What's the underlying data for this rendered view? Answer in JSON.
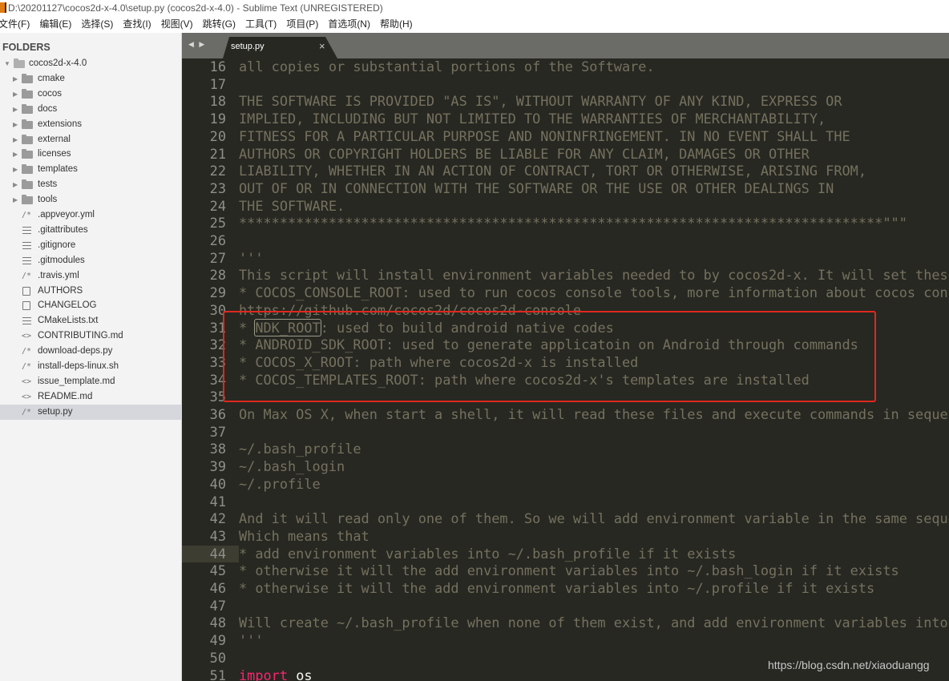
{
  "window": {
    "title": "D:\\20201127\\cocos2d-x-4.0\\setup.py (cocos2d-x-4.0) - Sublime Text (UNREGISTERED)",
    "app_icon": "sublime-text-icon"
  },
  "menubar": {
    "items": [
      "文件(F)",
      "编辑(E)",
      "选择(S)",
      "查找(I)",
      "视图(V)",
      "跳转(G)",
      "工具(T)",
      "项目(P)",
      "首选项(N)",
      "帮助(H)"
    ]
  },
  "sidebar": {
    "header": "FOLDERS",
    "root": {
      "label": "cocos2d-x-4.0",
      "icon": "folder-open-icon",
      "expanded": true
    },
    "folders": [
      {
        "label": "cmake",
        "icon": "folder-icon"
      },
      {
        "label": "cocos",
        "icon": "folder-icon"
      },
      {
        "label": "docs",
        "icon": "folder-icon"
      },
      {
        "label": "extensions",
        "icon": "folder-icon"
      },
      {
        "label": "external",
        "icon": "folder-icon"
      },
      {
        "label": "licenses",
        "icon": "folder-icon"
      },
      {
        "label": "templates",
        "icon": "folder-icon"
      },
      {
        "label": "tests",
        "icon": "folder-icon"
      },
      {
        "label": "tools",
        "icon": "folder-icon"
      }
    ],
    "files": [
      {
        "label": ".appveyor.yml",
        "icon": "comment-file-icon",
        "glyph": "/*"
      },
      {
        "label": ".gitattributes",
        "icon": "text-lines-icon",
        "glyph": ""
      },
      {
        "label": ".gitignore",
        "icon": "text-lines-icon",
        "glyph": ""
      },
      {
        "label": ".gitmodules",
        "icon": "text-lines-icon",
        "glyph": ""
      },
      {
        "label": ".travis.yml",
        "icon": "comment-file-icon",
        "glyph": "/*"
      },
      {
        "label": "AUTHORS",
        "icon": "document-icon",
        "glyph": ""
      },
      {
        "label": "CHANGELOG",
        "icon": "document-icon",
        "glyph": ""
      },
      {
        "label": "CMakeLists.txt",
        "icon": "text-lines-icon",
        "glyph": ""
      },
      {
        "label": "CONTRIBUTING.md",
        "icon": "markup-file-icon",
        "glyph": "<>"
      },
      {
        "label": "download-deps.py",
        "icon": "comment-file-icon",
        "glyph": "/*"
      },
      {
        "label": "install-deps-linux.sh",
        "icon": "comment-file-icon",
        "glyph": "/*"
      },
      {
        "label": "issue_template.md",
        "icon": "markup-file-icon",
        "glyph": "<>"
      },
      {
        "label": "README.md",
        "icon": "markup-file-icon",
        "glyph": "<>"
      },
      {
        "label": "setup.py",
        "icon": "comment-file-icon",
        "glyph": "/*",
        "selected": true
      }
    ]
  },
  "tabs": {
    "nav_glyph": "◀ ▶",
    "items": [
      {
        "label": "setup.py",
        "close": "×",
        "active": true
      }
    ]
  },
  "editor": {
    "active_line": 44,
    "lines": [
      {
        "n": "16",
        "text": "all copies or substantial portions of the Software."
      },
      {
        "n": "17",
        "text": ""
      },
      {
        "n": "18",
        "text": "THE SOFTWARE IS PROVIDED \"AS IS\", WITHOUT WARRANTY OF ANY KIND, EXPRESS OR"
      },
      {
        "n": "19",
        "text": "IMPLIED, INCLUDING BUT NOT LIMITED TO THE WARRANTIES OF MERCHANTABILITY,"
      },
      {
        "n": "20",
        "text": "FITNESS FOR A PARTICULAR PURPOSE AND NONINFRINGEMENT. IN NO EVENT SHALL THE"
      },
      {
        "n": "21",
        "text": "AUTHORS OR COPYRIGHT HOLDERS BE LIABLE FOR ANY CLAIM, DAMAGES OR OTHER"
      },
      {
        "n": "22",
        "text": "LIABILITY, WHETHER IN AN ACTION OF CONTRACT, TORT OR OTHERWISE, ARISING FROM,"
      },
      {
        "n": "23",
        "text": "OUT OF OR IN CONNECTION WITH THE SOFTWARE OR THE USE OR OTHER DEALINGS IN"
      },
      {
        "n": "24",
        "text": "THE SOFTWARE."
      },
      {
        "n": "25",
        "text": "*******************************************************************************\"\"\""
      },
      {
        "n": "26",
        "text": ""
      },
      {
        "n": "27",
        "text": "'''"
      },
      {
        "n": "28",
        "text": "This script will install environment variables needed to by cocos2d-x. It will set these envrironment variables:"
      },
      {
        "n": "29",
        "text": "* COCOS_CONSOLE_ROOT: used to run cocos console tools, more information about cocos console tools please refer to"
      },
      {
        "n": "30",
        "text": "https://github.com/cocos2d/cocos2d-console"
      },
      {
        "n": "31",
        "text": "* NDK_ROOT: used to build android native codes",
        "boxed_token": "NDK_ROOT"
      },
      {
        "n": "32",
        "text": "* ANDROID_SDK_ROOT: used to generate applicatoin on Android through commands"
      },
      {
        "n": "33",
        "text": "* COCOS_X_ROOT: path where cocos2d-x is installed"
      },
      {
        "n": "34",
        "text": "* COCOS_TEMPLATES_ROOT: path where cocos2d-x's templates are installed"
      },
      {
        "n": "35",
        "text": ""
      },
      {
        "n": "36",
        "text": "On Max OS X, when start a shell, it will read these files and execute commands in sequence:"
      },
      {
        "n": "37",
        "text": ""
      },
      {
        "n": "38",
        "text": "~/.bash_profile"
      },
      {
        "n": "39",
        "text": "~/.bash_login"
      },
      {
        "n": "40",
        "text": "~/.profile"
      },
      {
        "n": "41",
        "text": ""
      },
      {
        "n": "42",
        "text": "And it will read only one of them. So we will add environment variable in the same sequence."
      },
      {
        "n": "43",
        "text": "Which means that"
      },
      {
        "n": "44",
        "text": "* add environment variables into ~/.bash_profile if it exists"
      },
      {
        "n": "45",
        "text": "* otherwise it will the add environment variables into ~/.bash_login if it exists"
      },
      {
        "n": "46",
        "text": "* otherwise it will the add environment variables into ~/.profile if it exists"
      },
      {
        "n": "47",
        "text": ""
      },
      {
        "n": "48",
        "text": "Will create ~/.bash_profile when none of them exist, and add environment variables into it."
      },
      {
        "n": "49",
        "text": "'''"
      },
      {
        "n": "50",
        "text": ""
      },
      {
        "n": "51",
        "text": "",
        "keyword": "import",
        "identifier": "os"
      }
    ]
  },
  "annotation": {
    "label": "highlighted-env-vars",
    "color": "#e0281e"
  },
  "watermark": "https://blog.csdn.net/xiaoduangg",
  "colors": {
    "editor_bg": "#272822",
    "comment": "#75715e",
    "keyword": "#f92672",
    "gutter": "#8f908a",
    "sidebar_bg": "#f3f3f3",
    "highlight_box": "#e0281e"
  }
}
